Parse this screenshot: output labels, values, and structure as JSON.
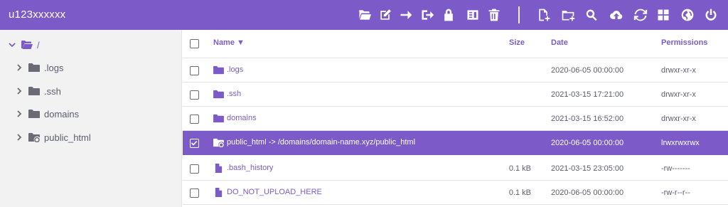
{
  "app": {
    "title": "u123xxxxxx"
  },
  "toolbar": {
    "left_icons": [
      "folder-open-icon",
      "edit-icon",
      "move-arrow-icon",
      "sign-out-icon",
      "lock-icon",
      "archive-icon",
      "trash-icon"
    ],
    "right_icons": [
      "new-file-icon",
      "new-folder-icon",
      "search-icon",
      "upload-cloud-icon",
      "refresh-icon",
      "grid-view-icon",
      "globe-icon",
      "power-icon"
    ]
  },
  "sidebar": {
    "root": {
      "label": "/"
    },
    "items": [
      {
        "label": ".logs",
        "icon": "folder-icon"
      },
      {
        "label": ".ssh",
        "icon": "folder-icon"
      },
      {
        "label": "domains",
        "icon": "folder-icon"
      },
      {
        "label": "public_html",
        "icon": "folder-link-icon"
      }
    ]
  },
  "table": {
    "headers": {
      "name": "Name ▼",
      "size": "Size",
      "date": "Date",
      "permissions": "Permissions"
    },
    "rows": [
      {
        "name": ".logs",
        "icon": "folder-icon",
        "size": "",
        "date": "2020-06-05 00:00:00",
        "permissions": "drwxr-xr-x",
        "selected": false
      },
      {
        "name": ".ssh",
        "icon": "folder-icon",
        "size": "",
        "date": "2021-03-15 17:21:00",
        "permissions": "drwxr-xr-x",
        "selected": false
      },
      {
        "name": "domains",
        "icon": "folder-icon",
        "size": "",
        "date": "2021-03-15 16:52:00",
        "permissions": "drwxr-xr-x",
        "selected": false
      },
      {
        "name": "public_html -> /domains/domain-name.xyz/public_html",
        "icon": "folder-link-icon",
        "size": "",
        "date": "2020-06-05 00:00:00",
        "permissions": "lrwxrwxrwx",
        "selected": true
      },
      {
        "name": ".bash_history",
        "icon": "file-icon",
        "size": "0.1 kB",
        "date": "2021-03-15 23:05:00",
        "permissions": "-rw-------",
        "selected": false
      },
      {
        "name": "DO_NOT_UPLOAD_HERE",
        "icon": "file-icon",
        "size": "0.1 kB",
        "date": "2020-06-05 00:00:00",
        "permissions": "-rw-r--r--",
        "selected": false
      }
    ]
  },
  "colors": {
    "accent": "#7c5ac7",
    "sidebar_bg": "#f2f2f2",
    "text": "#5c5c6e"
  }
}
